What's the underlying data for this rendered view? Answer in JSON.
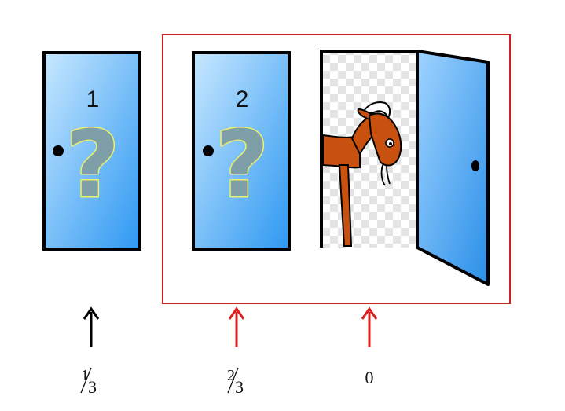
{
  "doors": [
    {
      "number": "1",
      "symbol": "?",
      "state": "closed"
    },
    {
      "number": "2",
      "symbol": "?",
      "state": "closed"
    },
    {
      "number": "",
      "symbol": "",
      "state": "open",
      "reveals": "goat"
    }
  ],
  "probabilities": [
    {
      "numerator": "1",
      "denominator": "3",
      "arrow_color": "#000000"
    },
    {
      "numerator": "2",
      "denominator": "3",
      "arrow_color": "#e02020"
    },
    {
      "value": "0",
      "arrow_color": "#e02020"
    }
  ],
  "colors": {
    "door_fill_light": "#bfe3ff",
    "door_fill_dark": "#2f9af3",
    "question_fill": "#7f9fa8",
    "question_stroke": "#eef06a",
    "highlight_box": "#cc2222",
    "goat_body": "#c9510f",
    "frame": "#000000"
  },
  "icons": [
    "question-mark-icon",
    "goat-icon",
    "arrow-up-icon"
  ]
}
